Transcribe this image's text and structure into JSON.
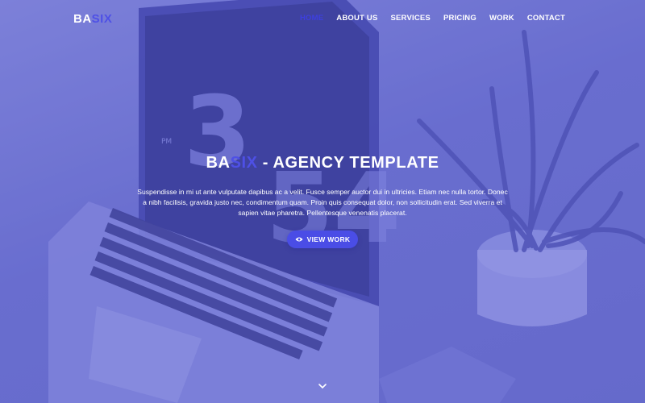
{
  "brand": {
    "logo_part1": "BA",
    "logo_part2": "SIX"
  },
  "nav": {
    "items": [
      {
        "label": "HOME",
        "active": true
      },
      {
        "label": "ABOUT US"
      },
      {
        "label": "SERVICES"
      },
      {
        "label": "PRICING"
      },
      {
        "label": "WORK"
      },
      {
        "label": "CONTACT"
      }
    ]
  },
  "hero": {
    "title_part1": "BA",
    "title_part2": "SIX",
    "title_part3": " - AGENCY TEMPLATE",
    "description": "Suspendisse in mi ut ante vulputate dapibus ac a velit. Fusce semper auctor dui in ultricies. Etiam nec nulla tortor. Donec a nibh facilisis, gravida justo nec, condimentum quam. Proin quis consequat dolor, non sollicitudin erat. Sed viverra et sapien vitae pharetra. Pellentesque venenatis placerat.",
    "cta_label": "VIEW WORK",
    "cta_icon": "eye-icon",
    "scroll_icon": "chevron-down-icon"
  },
  "colors": {
    "accent": "#4e50e6",
    "overlay": "#6f74cf",
    "text": "#ffffff"
  }
}
